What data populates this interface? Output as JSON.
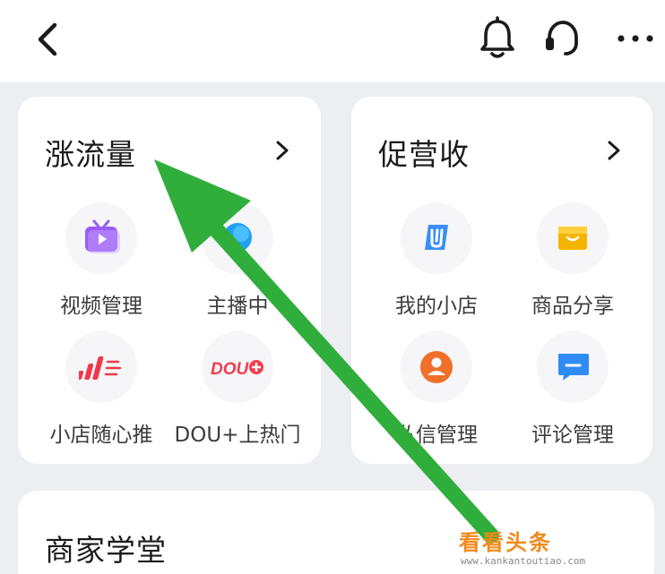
{
  "header": {
    "back_icon": "chevron-left-icon",
    "bell_icon": "bell-icon",
    "headset_icon": "headset-icon",
    "more_icon": "more-dots-icon"
  },
  "traffic_card": {
    "title": "涨流量",
    "items": [
      {
        "label": "视频管理",
        "icon": "video-tv-icon",
        "color": "#9b5cf6"
      },
      {
        "label": "主播中",
        "icon": "anchor-bubble-icon",
        "color": "#1da1f2"
      },
      {
        "label": "小店随心推",
        "icon": "boost-speed-icon",
        "color": "#f0384a"
      },
      {
        "label": "DOU+上热门",
        "icon": "dou-plus-icon",
        "color": "#f33b4c"
      }
    ]
  },
  "revenue_card": {
    "title": "促营收",
    "items": [
      {
        "label": "我的小店",
        "icon": "shop-logo-icon",
        "color": "#3a8ef6"
      },
      {
        "label": "商品分享",
        "icon": "shopping-bag-icon",
        "color": "#f5b400"
      },
      {
        "label": "私信管理",
        "icon": "user-circle-icon",
        "color": "#f0702a"
      },
      {
        "label": "评论管理",
        "icon": "comment-bubble-icon",
        "color": "#2f8cf5"
      }
    ]
  },
  "academy_card": {
    "title": "商家学堂"
  },
  "annotation": {
    "arrow_color": "#2fae3c"
  },
  "watermark": {
    "main": "看看头条",
    "sub": "www.kankantoutiao.com"
  }
}
